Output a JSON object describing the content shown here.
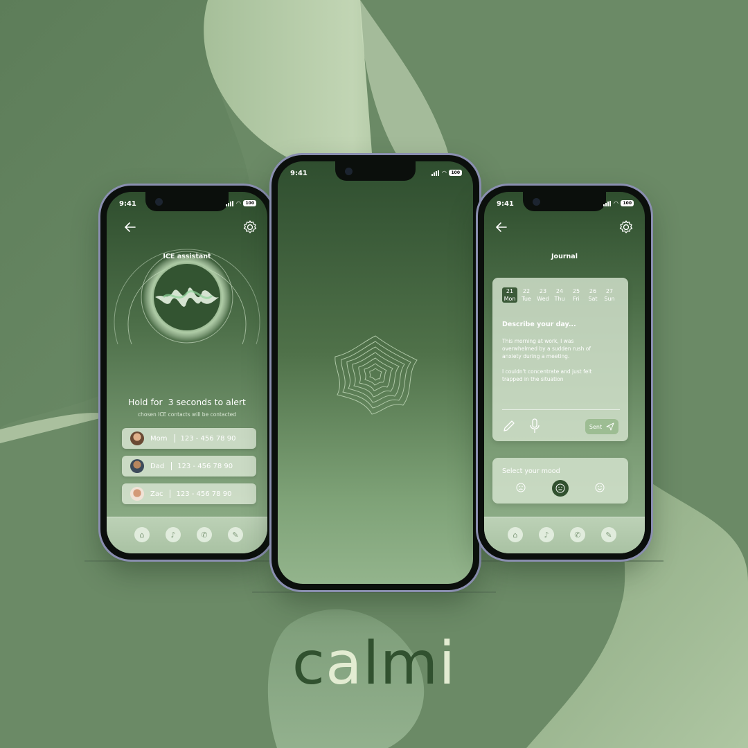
{
  "brand": {
    "logo": [
      "c",
      "a",
      "l",
      "m",
      "i"
    ],
    "logo_colors": [
      "#31512f",
      "#e3ecd2",
      "#31512f",
      "#31512f",
      "#e3ecd2"
    ]
  },
  "colors": {
    "bg": "#6f8e6a",
    "dark_green": "#31512f",
    "light_green": "#e3ecd2"
  },
  "status": {
    "time": "9:41",
    "battery": "100"
  },
  "ice_screen": {
    "back_icon": "arrow-left-icon",
    "settings_icon": "gear-icon",
    "title": "ICE assistant",
    "hold_text": "Hold for  3 seconds to alert",
    "sub_text": "chosen ICE contacts will be contacted",
    "contacts": [
      {
        "name": "Mom",
        "phone": "123 - 456 78 90"
      },
      {
        "name": "Dad",
        "phone": "123 - 456 78 90"
      },
      {
        "name": "Zac",
        "phone": "123 - 456 78 90"
      }
    ],
    "tabs": [
      "home-icon",
      "mic-icon",
      "phone-icon",
      "pen-icon"
    ]
  },
  "splash_screen": {
    "logo_icon": "contour-flower-icon"
  },
  "journal_screen": {
    "title": "Journal",
    "days": [
      {
        "num": "21",
        "name": "Mon",
        "selected": true
      },
      {
        "num": "22",
        "name": "Tue"
      },
      {
        "num": "23",
        "name": "Wed"
      },
      {
        "num": "24",
        "name": "Thu"
      },
      {
        "num": "25",
        "name": "Fri"
      },
      {
        "num": "26",
        "name": "Sat"
      },
      {
        "num": "27",
        "name": "Sun"
      }
    ],
    "prompt": "Describe your day...",
    "entry_p1_l1": "This morning at work, I was",
    "entry_p1_l2": "overwhelmed by a sudden rush of",
    "entry_p1_l3": "anxiety during a meeting.",
    "entry_p2_l1": "I couldn't concentrate and just felt",
    "entry_p2_l2": "trapped in the situation",
    "send_label": "Sent",
    "mood_title": "Select your mood",
    "moods": [
      "sad-face-icon",
      "neutral-face-icon",
      "happy-face-icon"
    ]
  }
}
